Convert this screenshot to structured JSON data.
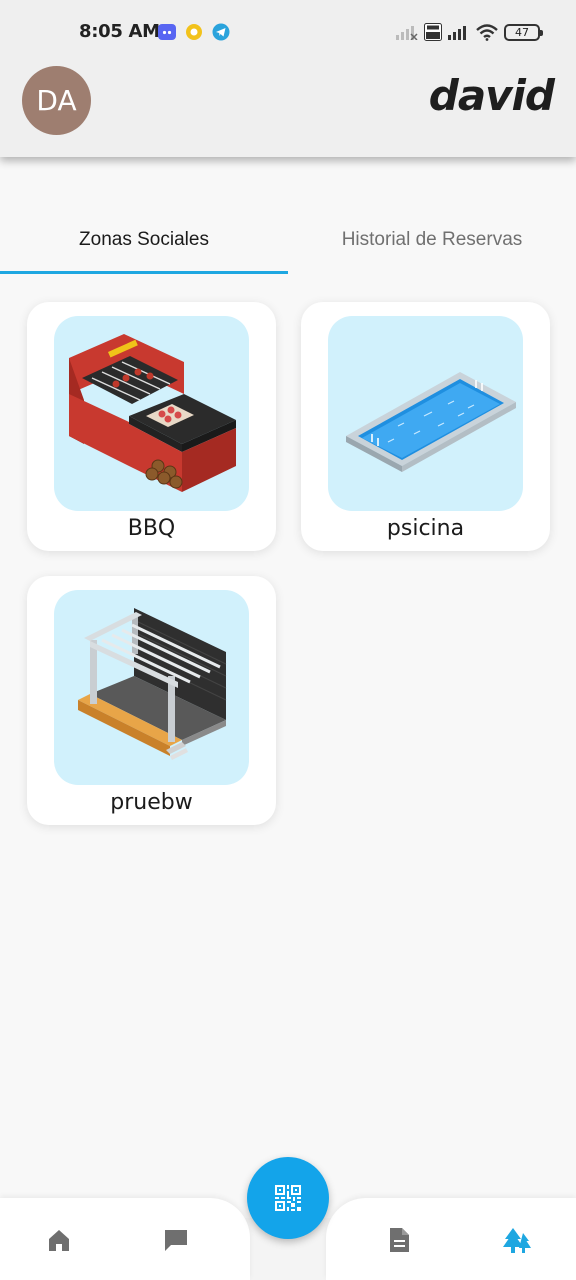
{
  "status_bar": {
    "time": "8:05 AM",
    "battery": "47",
    "notification_icons": [
      "discord-icon",
      "circle-app-icon",
      "telegram-icon"
    ],
    "system_icons": [
      "signal-x-icon",
      "volte-icon",
      "signal-icon",
      "wifi-icon",
      "battery-icon"
    ]
  },
  "header": {
    "avatar_initials": "DA",
    "username": "david",
    "avatar_color": "#9e7e70"
  },
  "tabs": [
    {
      "label": "Zonas Sociales",
      "active": true
    },
    {
      "label": "Historial de Reservas",
      "active": false
    }
  ],
  "zones": [
    {
      "name": "BBQ",
      "icon": "bbq-grill-image"
    },
    {
      "name": "psicina",
      "icon": "swimming-pool-image"
    },
    {
      "name": "pruebw",
      "icon": "pergola-image"
    }
  ],
  "bottom_nav": {
    "items": [
      "home-icon",
      "chat-icon",
      "document-icon",
      "trees-icon"
    ],
    "active": "trees-icon",
    "fab_icon": "qr-code-icon"
  },
  "colors": {
    "accent": "#1ea7e1",
    "fab": "#13a4ea",
    "thumb_bg": "#d1f1fc"
  }
}
